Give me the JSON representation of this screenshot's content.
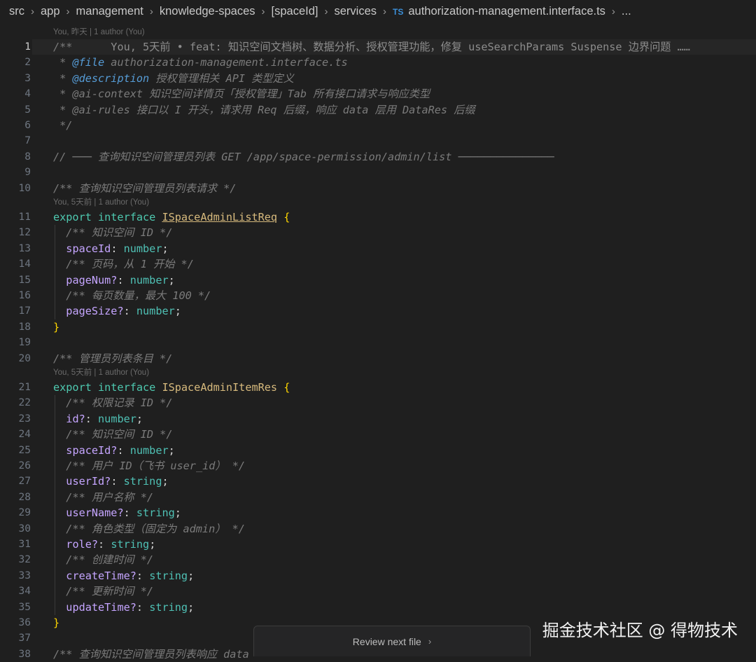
{
  "breadcrumb": {
    "items": [
      "src",
      "app",
      "management",
      "knowledge-spaces",
      "[spaceId]",
      "services"
    ],
    "file_badge": "TS",
    "file": "authorization-management.interface.ts",
    "more": "..."
  },
  "editor": {
    "active_line": 1,
    "blame_annotations": [
      {
        "before_line": 1,
        "text": "You, 昨天 | 1 author (You)"
      },
      {
        "before_line": 11,
        "text": "You, 5天前 | 1 author (You)"
      },
      {
        "before_line": 21,
        "text": "You, 5天前 | 1 author (You)"
      }
    ],
    "inline_blame": "      You, 5天前 • feat: 知识空间文档树、数据分析、授权管理功能，修复 useSearchParams Suspense 边界问题 ……",
    "lines": [
      {
        "n": 1,
        "tokens": [
          [
            "cm",
            "/**"
          ]
        ]
      },
      {
        "n": 2,
        "tokens": [
          [
            "cm",
            " * "
          ],
          [
            "tag",
            "@file"
          ],
          [
            "cm",
            " authorization-management.interface.ts"
          ]
        ]
      },
      {
        "n": 3,
        "tokens": [
          [
            "cm",
            " * "
          ],
          [
            "tag",
            "@description"
          ],
          [
            "cm",
            " 授权管理相关 API 类型定义"
          ]
        ]
      },
      {
        "n": 4,
        "tokens": [
          [
            "cm",
            " * @ai-context 知识空间详情页「授权管理」Tab 所有接口请求与响应类型"
          ]
        ]
      },
      {
        "n": 5,
        "tokens": [
          [
            "cm",
            " * @ai-rules 接口以 I 开头，请求用 Req 后缀，响应 data 层用 DataRes 后缀"
          ]
        ]
      },
      {
        "n": 6,
        "tokens": [
          [
            "cm",
            " */"
          ]
        ]
      },
      {
        "n": 7,
        "tokens": []
      },
      {
        "n": 8,
        "tokens": [
          [
            "cm",
            "// ─── 查询知识空间管理员列表 GET /app/space-permission/admin/list ───────────────"
          ]
        ]
      },
      {
        "n": 9,
        "tokens": []
      },
      {
        "n": 10,
        "tokens": [
          [
            "cm",
            "/** 查询知识空间管理员列表请求 */"
          ]
        ]
      },
      {
        "n": 11,
        "tokens": [
          [
            "kw",
            "export interface "
          ],
          [
            "iface",
            "ISpaceAdminListReq"
          ],
          [
            "punc",
            " "
          ],
          [
            "brace",
            "{"
          ]
        ]
      },
      {
        "n": 12,
        "tokens": [
          [
            "cm",
            "  /** 知识空间 ID */"
          ]
        ]
      },
      {
        "n": 13,
        "tokens": [
          [
            "punc",
            "  "
          ],
          [
            "prop",
            "spaceId"
          ],
          [
            "punc",
            ": "
          ],
          [
            "type",
            "number"
          ],
          [
            "punc",
            ";"
          ]
        ]
      },
      {
        "n": 14,
        "tokens": [
          [
            "cm",
            "  /** 页码，从 1 开始 */"
          ]
        ]
      },
      {
        "n": 15,
        "tokens": [
          [
            "punc",
            "  "
          ],
          [
            "prop",
            "pageNum?"
          ],
          [
            "punc",
            ": "
          ],
          [
            "type",
            "number"
          ],
          [
            "punc",
            ";"
          ]
        ]
      },
      {
        "n": 16,
        "tokens": [
          [
            "cm",
            "  /** 每页数量，最大 100 */"
          ]
        ]
      },
      {
        "n": 17,
        "tokens": [
          [
            "punc",
            "  "
          ],
          [
            "prop",
            "pageSize?"
          ],
          [
            "punc",
            ": "
          ],
          [
            "type",
            "number"
          ],
          [
            "punc",
            ";"
          ]
        ]
      },
      {
        "n": 18,
        "tokens": [
          [
            "brace",
            "}"
          ]
        ]
      },
      {
        "n": 19,
        "tokens": []
      },
      {
        "n": 20,
        "tokens": [
          [
            "cm",
            "/** 管理员列表条目 */"
          ]
        ]
      },
      {
        "n": 21,
        "tokens": [
          [
            "kw",
            "export interface "
          ],
          [
            "iface2",
            "ISpaceAdminItemRes"
          ],
          [
            "punc",
            " "
          ],
          [
            "brace",
            "{"
          ]
        ]
      },
      {
        "n": 22,
        "tokens": [
          [
            "cm",
            "  /** 权限记录 ID */"
          ]
        ]
      },
      {
        "n": 23,
        "tokens": [
          [
            "punc",
            "  "
          ],
          [
            "prop",
            "id?"
          ],
          [
            "punc",
            ": "
          ],
          [
            "type",
            "number"
          ],
          [
            "punc",
            ";"
          ]
        ]
      },
      {
        "n": 24,
        "tokens": [
          [
            "cm",
            "  /** 知识空间 ID */"
          ]
        ]
      },
      {
        "n": 25,
        "tokens": [
          [
            "punc",
            "  "
          ],
          [
            "prop",
            "spaceId?"
          ],
          [
            "punc",
            ": "
          ],
          [
            "type",
            "number"
          ],
          [
            "punc",
            ";"
          ]
        ]
      },
      {
        "n": 26,
        "tokens": [
          [
            "cm",
            "  /** 用户 ID（飞书 user_id） */"
          ]
        ]
      },
      {
        "n": 27,
        "tokens": [
          [
            "punc",
            "  "
          ],
          [
            "prop",
            "userId?"
          ],
          [
            "punc",
            ": "
          ],
          [
            "type",
            "string"
          ],
          [
            "punc",
            ";"
          ]
        ]
      },
      {
        "n": 28,
        "tokens": [
          [
            "cm",
            "  /** 用户名称 */"
          ]
        ]
      },
      {
        "n": 29,
        "tokens": [
          [
            "punc",
            "  "
          ],
          [
            "prop",
            "userName?"
          ],
          [
            "punc",
            ": "
          ],
          [
            "type",
            "string"
          ],
          [
            "punc",
            ";"
          ]
        ]
      },
      {
        "n": 30,
        "tokens": [
          [
            "cm",
            "  /** 角色类型（固定为 admin） */"
          ]
        ]
      },
      {
        "n": 31,
        "tokens": [
          [
            "punc",
            "  "
          ],
          [
            "prop",
            "role?"
          ],
          [
            "punc",
            ": "
          ],
          [
            "type",
            "string"
          ],
          [
            "punc",
            ";"
          ]
        ]
      },
      {
        "n": 32,
        "tokens": [
          [
            "cm",
            "  /** 创建时间 */"
          ]
        ]
      },
      {
        "n": 33,
        "tokens": [
          [
            "punc",
            "  "
          ],
          [
            "prop",
            "createTime?"
          ],
          [
            "punc",
            ": "
          ],
          [
            "type",
            "string"
          ],
          [
            "punc",
            ";"
          ]
        ]
      },
      {
        "n": 34,
        "tokens": [
          [
            "cm",
            "  /** 更新时间 */"
          ]
        ]
      },
      {
        "n": 35,
        "tokens": [
          [
            "punc",
            "  "
          ],
          [
            "prop",
            "updateTime?"
          ],
          [
            "punc",
            ": "
          ],
          [
            "type",
            "string"
          ],
          [
            "punc",
            ";"
          ]
        ]
      },
      {
        "n": 36,
        "tokens": [
          [
            "brace",
            "}"
          ]
        ]
      },
      {
        "n": 37,
        "tokens": []
      },
      {
        "n": 38,
        "tokens": [
          [
            "cm",
            "/** 查询知识空间管理员列表响应 data"
          ]
        ]
      }
    ]
  },
  "review_bar": {
    "label": "Review next file",
    "chevron": "›"
  },
  "watermark": "掘金技术社区 @ 得物技术"
}
